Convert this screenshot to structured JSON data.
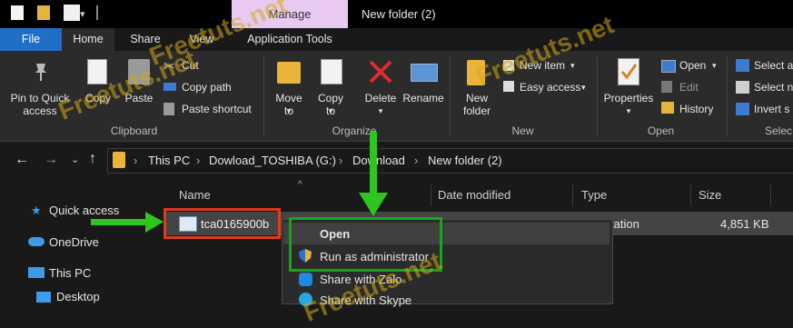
{
  "title_bar": {
    "manage_tab": "Manage",
    "window_title": "New folder (2)"
  },
  "ribbon_tabs": [
    "File",
    "Home",
    "Share",
    "View",
    "Application Tools"
  ],
  "ribbon": {
    "clipboard": {
      "group_label": "Clipboard",
      "pin_to_quick_access": "Pin to Quick access",
      "copy": "Copy",
      "paste": "Paste",
      "cut": "Cut",
      "copy_path": "Copy path",
      "paste_shortcut": "Paste shortcut"
    },
    "organize": {
      "group_label": "Organize",
      "move_to": "Move to",
      "copy_to": "Copy to",
      "delete": "Delete",
      "rename": "Rename"
    },
    "new": {
      "group_label": "New",
      "new_folder": "New folder",
      "new_item": "New item",
      "easy_access": "Easy access"
    },
    "open": {
      "group_label": "Open",
      "properties": "Properties",
      "open": "Open",
      "edit": "Edit",
      "history": "History"
    },
    "select": {
      "group_label": "Selec",
      "select_all": "Select a",
      "select_none": "Select n",
      "invert_selection": "Invert s"
    }
  },
  "address_bar": {
    "crumbs": [
      "This PC",
      "Dowload_TOSHIBA (G:)",
      "Download",
      "New folder (2)"
    ]
  },
  "nav_pane": {
    "quick_access": "Quick access",
    "onedrive": "OneDrive",
    "this_pc": "This PC",
    "desktop": "Desktop"
  },
  "file_list": {
    "columns": [
      "Name",
      "Date modified",
      "Type",
      "Size"
    ],
    "rows": [
      {
        "name": "tca0165900b",
        "type": "tation",
        "size": "4,851 KB"
      }
    ]
  },
  "context_menu": {
    "items": [
      "Open",
      "Run as administrator",
      "Share with Zalo",
      "Share with Skype"
    ]
  },
  "watermark": "Freetuts.net",
  "colors": {
    "accent": "#1f6fc9",
    "highlight_red": "#e03a1e",
    "highlight_green": "#17a61a",
    "arrow_green": "#2fc41e"
  }
}
